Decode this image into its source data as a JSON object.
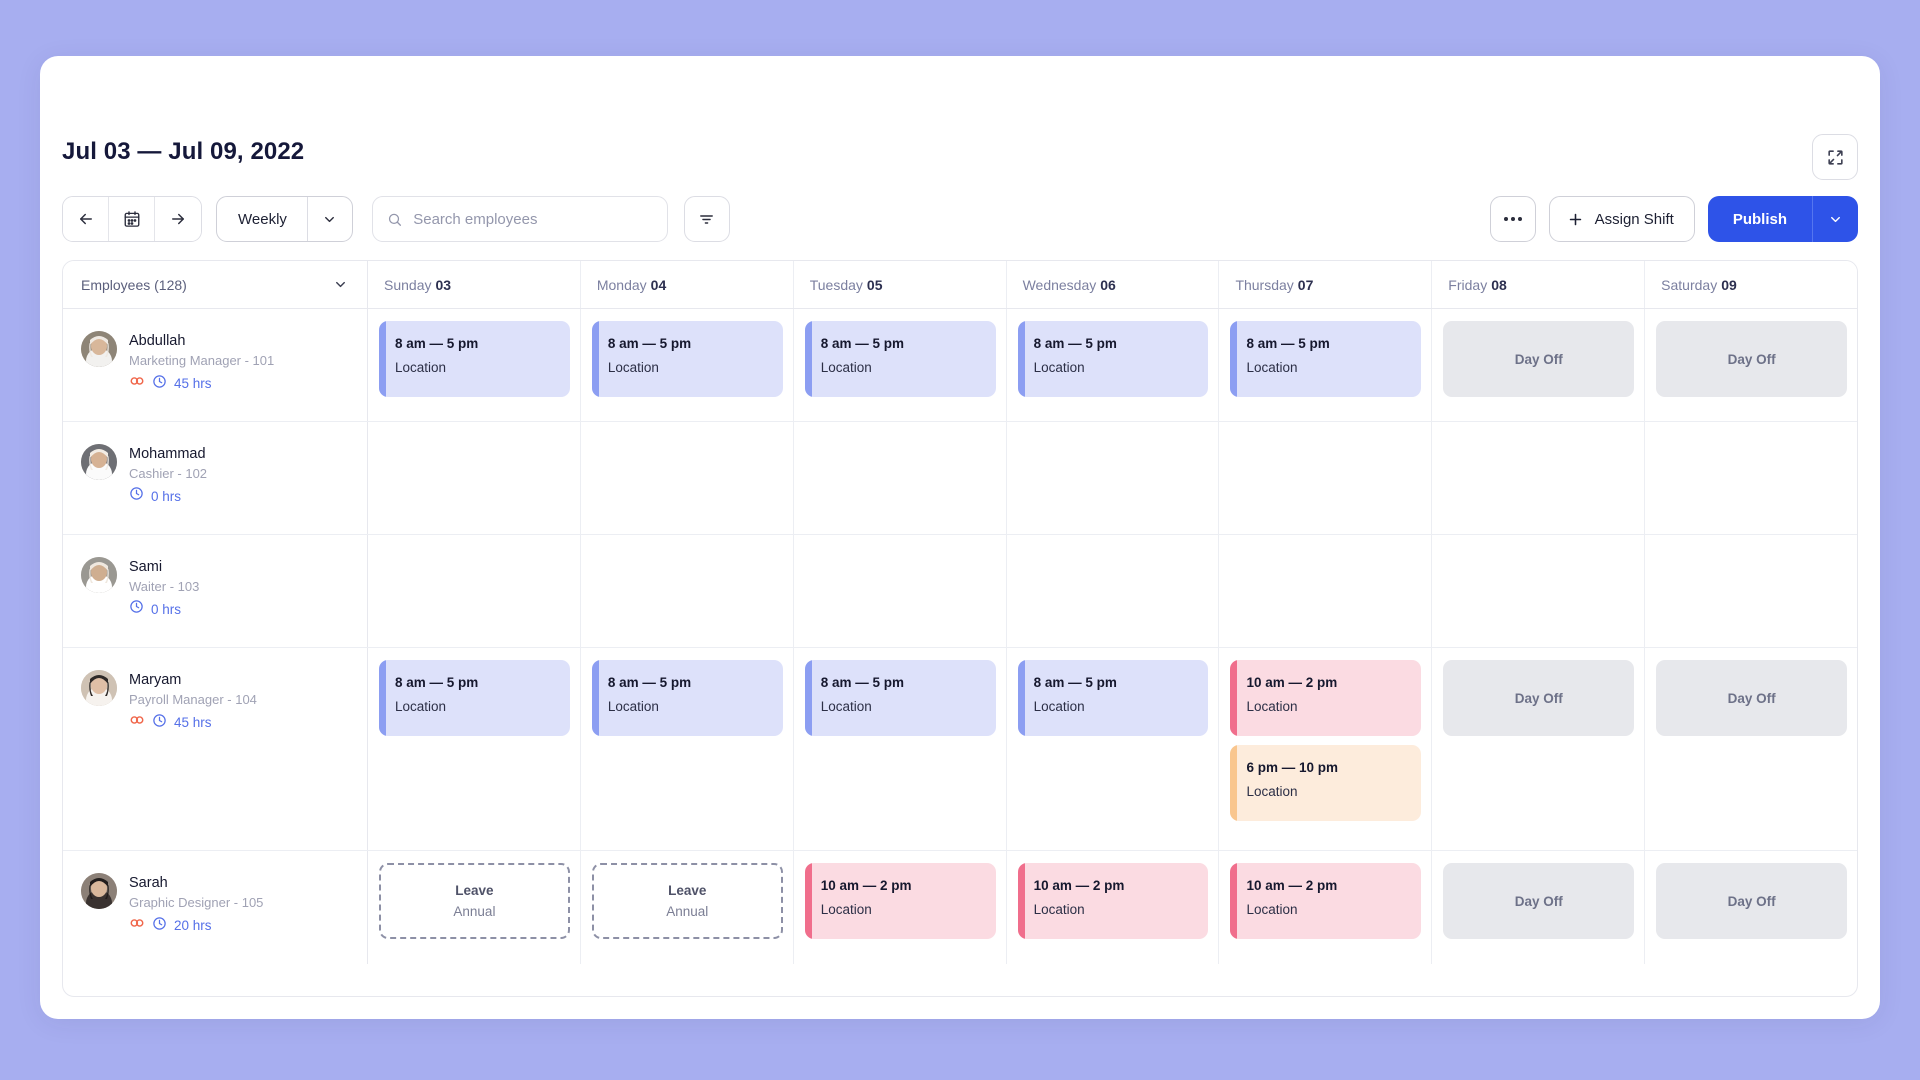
{
  "header": {
    "title": "Jul 03 — Jul 09, 2022",
    "expand_icon": "expand-icon"
  },
  "toolbar": {
    "prev_icon": "arrow-left-icon",
    "calendar_icon": "calendar-icon",
    "next_icon": "arrow-right-icon",
    "view_label": "Weekly",
    "view_caret_icon": "chevron-down-icon",
    "search_placeholder": "Search employees",
    "search_value": "",
    "search_icon": "search-icon",
    "filter_icon": "filter-icon",
    "more_label": "...",
    "more_icon": "ellipsis-icon",
    "assign_label": "Assign Shift",
    "assign_icon": "plus-icon",
    "publish_label": "Publish",
    "publish_caret_icon": "chevron-down-icon",
    "accent_color": "#2e53e8"
  },
  "grid": {
    "employees_header": "Employees (128)",
    "employees_caret_icon": "chevron-down-icon",
    "days": [
      {
        "name": "Sunday",
        "date": "03"
      },
      {
        "name": "Monday",
        "date": "04"
      },
      {
        "name": "Tuesday",
        "date": "05"
      },
      {
        "name": "Wednesday",
        "date": "06"
      },
      {
        "name": "Thursday",
        "date": "07"
      },
      {
        "name": "Friday",
        "date": "08"
      },
      {
        "name": "Saturday",
        "date": "09"
      }
    ],
    "rows": [
      {
        "name": "Abdullah",
        "role": "Marketing Manager - 101",
        "hours": "45 hrs",
        "has_link_icon": true,
        "link_icon": "link-icon",
        "clock_icon": "clock-icon",
        "cells": [
          {
            "type": "shift",
            "color": "blue",
            "time": "8 am — 5 pm",
            "location": "Location"
          },
          {
            "type": "shift",
            "color": "blue",
            "time": "8 am — 5 pm",
            "location": "Location"
          },
          {
            "type": "shift",
            "color": "blue",
            "time": "8 am — 5 pm",
            "location": "Location"
          },
          {
            "type": "shift",
            "color": "blue",
            "time": "8 am — 5 pm",
            "location": "Location"
          },
          {
            "type": "shift",
            "color": "blue",
            "time": "8 am — 5 pm",
            "location": "Location"
          },
          {
            "type": "dayoff",
            "label": "Day Off"
          },
          {
            "type": "dayoff",
            "label": "Day Off"
          }
        ]
      },
      {
        "name": "Mohammad",
        "role": "Cashier - 102",
        "hours": "0 hrs",
        "has_link_icon": false,
        "clock_icon": "clock-icon",
        "cells": [
          {
            "type": "empty"
          },
          {
            "type": "empty"
          },
          {
            "type": "empty"
          },
          {
            "type": "empty"
          },
          {
            "type": "empty"
          },
          {
            "type": "empty"
          },
          {
            "type": "empty"
          }
        ]
      },
      {
        "name": "Sami",
        "role": "Waiter - 103",
        "hours": "0 hrs",
        "has_link_icon": false,
        "clock_icon": "clock-icon",
        "cells": [
          {
            "type": "empty"
          },
          {
            "type": "empty"
          },
          {
            "type": "empty"
          },
          {
            "type": "empty"
          },
          {
            "type": "empty"
          },
          {
            "type": "empty"
          },
          {
            "type": "empty"
          }
        ]
      },
      {
        "name": "Maryam",
        "role": "Payroll Manager - 104",
        "hours": "45 hrs",
        "has_link_icon": true,
        "link_icon": "link-icon",
        "clock_icon": "clock-icon",
        "cells": [
          {
            "type": "shift",
            "color": "blue",
            "time": "8 am — 5 pm",
            "location": "Location"
          },
          {
            "type": "shift",
            "color": "blue",
            "time": "8 am — 5 pm",
            "location": "Location"
          },
          {
            "type": "shift",
            "color": "blue",
            "time": "8 am — 5 pm",
            "location": "Location"
          },
          {
            "type": "shift",
            "color": "blue",
            "time": "8 am — 5 pm",
            "location": "Location"
          },
          {
            "type": "multi",
            "shifts": [
              {
                "color": "pink",
                "time": "10 am — 2 pm",
                "location": "Location"
              },
              {
                "color": "peach",
                "time": "6 pm — 10 pm",
                "location": "Location"
              }
            ]
          },
          {
            "type": "dayoff",
            "label": "Day Off"
          },
          {
            "type": "dayoff",
            "label": "Day Off"
          }
        ]
      },
      {
        "name": "Sarah",
        "role": "Graphic Designer - 105",
        "hours": "20 hrs",
        "has_link_icon": true,
        "link_icon": "link-icon",
        "clock_icon": "clock-icon",
        "cells": [
          {
            "type": "leave",
            "title": "Leave",
            "subtype": "Annual"
          },
          {
            "type": "leave",
            "title": "Leave",
            "subtype": "Annual"
          },
          {
            "type": "shift",
            "color": "pink",
            "time": "10 am — 2 pm",
            "location": "Location"
          },
          {
            "type": "shift",
            "color": "pink",
            "time": "10 am — 2 pm",
            "location": "Location"
          },
          {
            "type": "shift",
            "color": "pink",
            "time": "10 am — 2 pm",
            "location": "Location"
          },
          {
            "type": "dayoff",
            "label": "Day Off"
          },
          {
            "type": "dayoff",
            "label": "Day Off"
          }
        ]
      }
    ]
  }
}
